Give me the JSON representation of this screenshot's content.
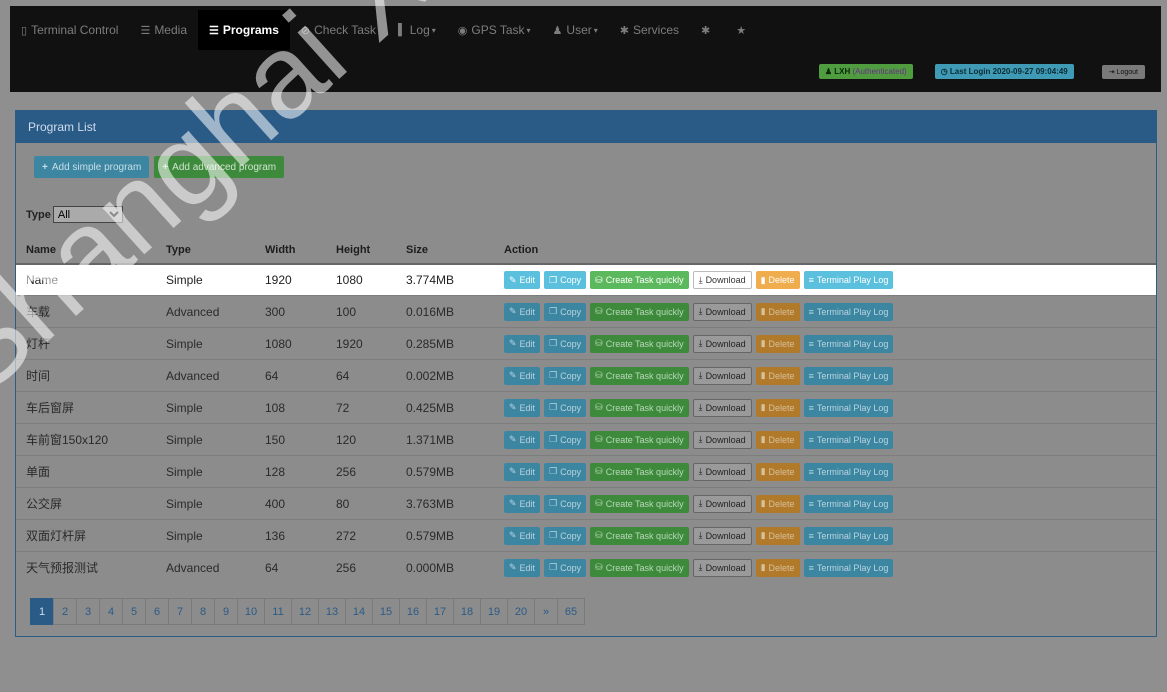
{
  "nav": {
    "items": [
      {
        "icon": "▯",
        "label": "Terminal Control",
        "caret": ""
      },
      {
        "icon": "☰",
        "label": "Media",
        "caret": ""
      },
      {
        "icon": "☰",
        "label": "Programs",
        "caret": ""
      },
      {
        "icon": "⊘",
        "label": "Check Task",
        "caret": ""
      },
      {
        "icon": "▌",
        "label": "Log",
        "caret": "▾"
      },
      {
        "icon": "◉",
        "label": "GPS Task",
        "caret": "▾"
      },
      {
        "icon": "♟",
        "label": "User",
        "caret": "▾"
      },
      {
        "icon": "✱",
        "label": "Services",
        "caret": ""
      },
      {
        "icon": "✱",
        "label": "",
        "caret": ""
      },
      {
        "icon": "★",
        "label": "",
        "caret": ""
      }
    ],
    "active_index": 2,
    "user_label": "LXH",
    "user_status": "(Authenticated)",
    "last_login": "Last Login 2020-09-27 09:04:49",
    "logout": "Logout"
  },
  "panel": {
    "title": "Program List",
    "add_simple": "Add simple program",
    "add_advanced": "Add advanced program",
    "type_label": "Type",
    "type_selected": "All"
  },
  "table": {
    "headers": [
      "Name",
      "Type",
      "Width",
      "Height",
      "Size",
      "Action"
    ],
    "actions": {
      "edit": "Edit",
      "copy": "Copy",
      "create_task": "Create Task quickly",
      "download": "Download",
      "delete": "Delete",
      "play_log": "Terminal Play Log"
    },
    "rows": [
      {
        "name": "Name",
        "type": "Simple",
        "width": "1920",
        "height": "1080",
        "size": "3.774MB",
        "highlighted": true
      },
      {
        "name": "车载",
        "type": "Advanced",
        "width": "300",
        "height": "100",
        "size": "0.016MB"
      },
      {
        "name": "灯杆",
        "type": "Simple",
        "width": "1080",
        "height": "1920",
        "size": "0.285MB"
      },
      {
        "name": "时间",
        "type": "Advanced",
        "width": "64",
        "height": "64",
        "size": "0.002MB"
      },
      {
        "name": "车后窗屏",
        "type": "Simple",
        "width": "108",
        "height": "72",
        "size": "0.425MB"
      },
      {
        "name": "车前窗150x120",
        "type": "Simple",
        "width": "150",
        "height": "120",
        "size": "1.371MB"
      },
      {
        "name": "单面",
        "type": "Simple",
        "width": "128",
        "height": "256",
        "size": "0.579MB"
      },
      {
        "name": "公交屏",
        "type": "Simple",
        "width": "400",
        "height": "80",
        "size": "3.763MB"
      },
      {
        "name": "双面灯杆屏",
        "type": "Simple",
        "width": "136",
        "height": "272",
        "size": "0.579MB"
      },
      {
        "name": "天气预报测试",
        "type": "Advanced",
        "width": "64",
        "height": "256",
        "size": "0.000MB"
      }
    ]
  },
  "pagination": [
    "1",
    "2",
    "3",
    "4",
    "5",
    "6",
    "7",
    "8",
    "9",
    "10",
    "11",
    "12",
    "13",
    "14",
    "15",
    "16",
    "17",
    "18",
    "19",
    "20",
    "»",
    "65"
  ],
  "pagination_active": "1",
  "watermark": "Shanghai XiXun Electronic"
}
